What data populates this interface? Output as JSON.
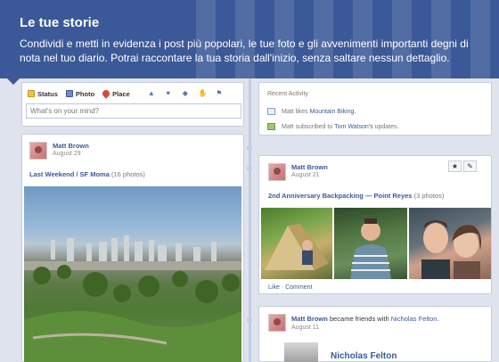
{
  "banner": {
    "title": "Le tue storie",
    "text": "Condividi e metti in evidenza i post più popolari, le tue foto e gli avvenimenti importanti degni di nota nel tuo diario. Potrai raccontare la tua storia dall'inizio, senza saltare nessun dettaglio."
  },
  "composer": {
    "tabs": [
      "Status",
      "Photo",
      "Place"
    ],
    "placeholder": "What's on your mind?"
  },
  "activity": {
    "heading": "Recent Activity",
    "row1": {
      "actor": "Matt",
      "verb": "likes",
      "object": "Mountain Biking."
    },
    "row2": {
      "actor": "Matt",
      "verb": "subscribed to",
      "object": "Tom Watson's",
      "suffix": "updates."
    }
  },
  "post_left": {
    "name": "Matt Brown",
    "date": "August 29",
    "album": "Last Weekend / SF Moma",
    "count": "(16 photos)"
  },
  "post_r1": {
    "name": "Matt Brown",
    "date": "August 21",
    "album": "2nd Anniversary Backpacking",
    "sep": "—",
    "place": "Point Reyes",
    "count": "(3 photos)",
    "like": "Like",
    "dot": "·",
    "comment": "Comment"
  },
  "post_r2": {
    "name": "Matt Brown",
    "verb": "became friends with",
    "friend": "Nicholas Felton.",
    "date": "August 11",
    "friend_card": "Nicholas Felton"
  },
  "icons": {
    "star": "★",
    "pencil": "✎"
  },
  "colors": {
    "brand": "#3b5998",
    "background": "#dfe3ee"
  }
}
